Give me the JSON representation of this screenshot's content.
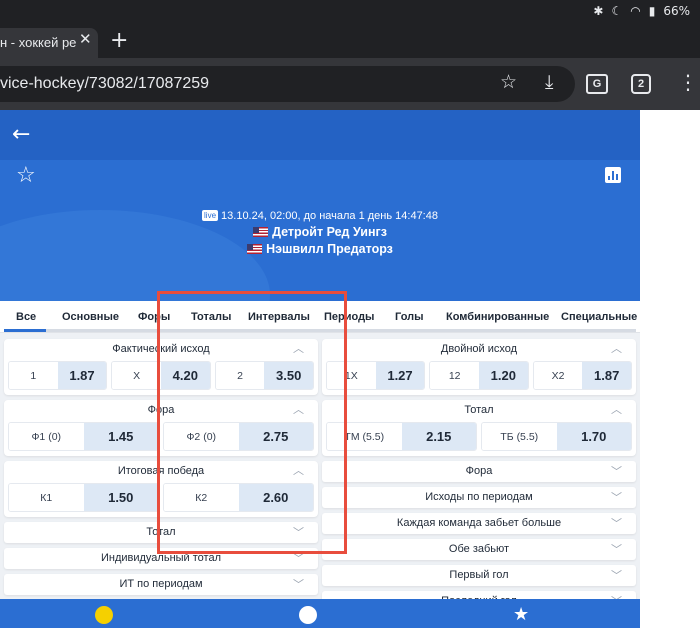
{
  "status": {
    "battery": "66"
  },
  "browser": {
    "tab_title": "н - хоккей ре",
    "url": "vice-hockey/73082/17087259",
    "tab_count": "2",
    "translate_label": "G"
  },
  "match": {
    "live_label": "live",
    "date_text": "13.10.24, 02:00, до начала  1 день  14:47:48",
    "team1": "Детройт Ред Уингз",
    "team2": "Нэшвилл Предаторз"
  },
  "categories": [
    "Все",
    "Основные",
    "Форы",
    "Тоталы",
    "Интервалы",
    "Периоды",
    "Голы",
    "Комбинированные",
    "Специальные"
  ],
  "left_markets": [
    {
      "title": "Фактический исход",
      "odds": [
        {
          "label": "1",
          "value": "1.87"
        },
        {
          "label": "X",
          "value": "4.20"
        },
        {
          "label": "2",
          "value": "3.50"
        }
      ]
    },
    {
      "title": "Фора",
      "odds": [
        {
          "label": "Ф1 (0)",
          "value": "1.45"
        },
        {
          "label": "Ф2 (0)",
          "value": "2.75"
        }
      ]
    },
    {
      "title": "Итоговая победа",
      "odds": [
        {
          "label": "К1",
          "value": "1.50"
        },
        {
          "label": "К2",
          "value": "2.60"
        }
      ]
    }
  ],
  "left_collapsed": [
    "Тотал",
    "Индивидуальный тотал",
    "ИТ по периодам"
  ],
  "right_markets": [
    {
      "title": "Двойной исход",
      "odds": [
        {
          "label": "1X",
          "value": "1.27"
        },
        {
          "label": "12",
          "value": "1.20"
        },
        {
          "label": "X2",
          "value": "1.87"
        }
      ]
    },
    {
      "title": "Тотал",
      "odds": [
        {
          "label": "ТМ (5.5)",
          "value": "2.15"
        },
        {
          "label": "ТБ (5.5)",
          "value": "1.70"
        }
      ]
    }
  ],
  "right_collapsed": [
    "Фора",
    "Исходы по периодам",
    "Каждая команда забьет больше",
    "Обе забьют",
    "Первый гол",
    "Последний гол"
  ],
  "colors": {
    "brand": "#2b6ed2",
    "highlight": "#e84d3d"
  }
}
